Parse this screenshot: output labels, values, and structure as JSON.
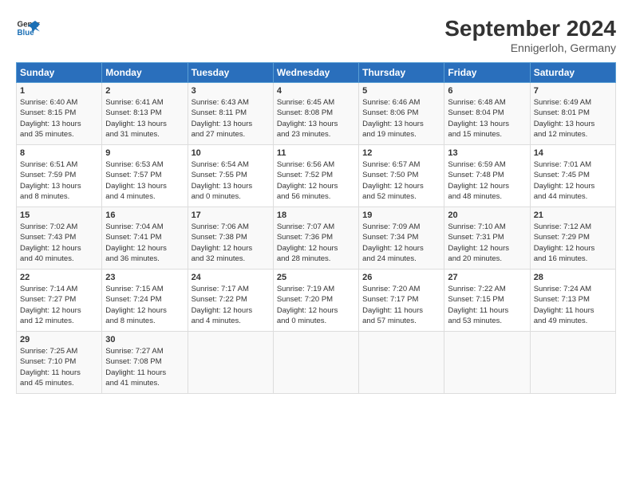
{
  "header": {
    "logo_line1": "General",
    "logo_line2": "Blue",
    "title": "September 2024",
    "subtitle": "Ennigerloh, Germany"
  },
  "days_of_week": [
    "Sunday",
    "Monday",
    "Tuesday",
    "Wednesday",
    "Thursday",
    "Friday",
    "Saturday"
  ],
  "rows": [
    [
      {
        "day": 1,
        "lines": [
          "Sunrise: 6:40 AM",
          "Sunset: 8:15 PM",
          "Daylight: 13 hours",
          "and 35 minutes."
        ]
      },
      {
        "day": 2,
        "lines": [
          "Sunrise: 6:41 AM",
          "Sunset: 8:13 PM",
          "Daylight: 13 hours",
          "and 31 minutes."
        ]
      },
      {
        "day": 3,
        "lines": [
          "Sunrise: 6:43 AM",
          "Sunset: 8:11 PM",
          "Daylight: 13 hours",
          "and 27 minutes."
        ]
      },
      {
        "day": 4,
        "lines": [
          "Sunrise: 6:45 AM",
          "Sunset: 8:08 PM",
          "Daylight: 13 hours",
          "and 23 minutes."
        ]
      },
      {
        "day": 5,
        "lines": [
          "Sunrise: 6:46 AM",
          "Sunset: 8:06 PM",
          "Daylight: 13 hours",
          "and 19 minutes."
        ]
      },
      {
        "day": 6,
        "lines": [
          "Sunrise: 6:48 AM",
          "Sunset: 8:04 PM",
          "Daylight: 13 hours",
          "and 15 minutes."
        ]
      },
      {
        "day": 7,
        "lines": [
          "Sunrise: 6:49 AM",
          "Sunset: 8:01 PM",
          "Daylight: 13 hours",
          "and 12 minutes."
        ]
      }
    ],
    [
      {
        "day": 8,
        "lines": [
          "Sunrise: 6:51 AM",
          "Sunset: 7:59 PM",
          "Daylight: 13 hours",
          "and 8 minutes."
        ]
      },
      {
        "day": 9,
        "lines": [
          "Sunrise: 6:53 AM",
          "Sunset: 7:57 PM",
          "Daylight: 13 hours",
          "and 4 minutes."
        ]
      },
      {
        "day": 10,
        "lines": [
          "Sunrise: 6:54 AM",
          "Sunset: 7:55 PM",
          "Daylight: 13 hours",
          "and 0 minutes."
        ]
      },
      {
        "day": 11,
        "lines": [
          "Sunrise: 6:56 AM",
          "Sunset: 7:52 PM",
          "Daylight: 12 hours",
          "and 56 minutes."
        ]
      },
      {
        "day": 12,
        "lines": [
          "Sunrise: 6:57 AM",
          "Sunset: 7:50 PM",
          "Daylight: 12 hours",
          "and 52 minutes."
        ]
      },
      {
        "day": 13,
        "lines": [
          "Sunrise: 6:59 AM",
          "Sunset: 7:48 PM",
          "Daylight: 12 hours",
          "and 48 minutes."
        ]
      },
      {
        "day": 14,
        "lines": [
          "Sunrise: 7:01 AM",
          "Sunset: 7:45 PM",
          "Daylight: 12 hours",
          "and 44 minutes."
        ]
      }
    ],
    [
      {
        "day": 15,
        "lines": [
          "Sunrise: 7:02 AM",
          "Sunset: 7:43 PM",
          "Daylight: 12 hours",
          "and 40 minutes."
        ]
      },
      {
        "day": 16,
        "lines": [
          "Sunrise: 7:04 AM",
          "Sunset: 7:41 PM",
          "Daylight: 12 hours",
          "and 36 minutes."
        ]
      },
      {
        "day": 17,
        "lines": [
          "Sunrise: 7:06 AM",
          "Sunset: 7:38 PM",
          "Daylight: 12 hours",
          "and 32 minutes."
        ]
      },
      {
        "day": 18,
        "lines": [
          "Sunrise: 7:07 AM",
          "Sunset: 7:36 PM",
          "Daylight: 12 hours",
          "and 28 minutes."
        ]
      },
      {
        "day": 19,
        "lines": [
          "Sunrise: 7:09 AM",
          "Sunset: 7:34 PM",
          "Daylight: 12 hours",
          "and 24 minutes."
        ]
      },
      {
        "day": 20,
        "lines": [
          "Sunrise: 7:10 AM",
          "Sunset: 7:31 PM",
          "Daylight: 12 hours",
          "and 20 minutes."
        ]
      },
      {
        "day": 21,
        "lines": [
          "Sunrise: 7:12 AM",
          "Sunset: 7:29 PM",
          "Daylight: 12 hours",
          "and 16 minutes."
        ]
      }
    ],
    [
      {
        "day": 22,
        "lines": [
          "Sunrise: 7:14 AM",
          "Sunset: 7:27 PM",
          "Daylight: 12 hours",
          "and 12 minutes."
        ]
      },
      {
        "day": 23,
        "lines": [
          "Sunrise: 7:15 AM",
          "Sunset: 7:24 PM",
          "Daylight: 12 hours",
          "and 8 minutes."
        ]
      },
      {
        "day": 24,
        "lines": [
          "Sunrise: 7:17 AM",
          "Sunset: 7:22 PM",
          "Daylight: 12 hours",
          "and 4 minutes."
        ]
      },
      {
        "day": 25,
        "lines": [
          "Sunrise: 7:19 AM",
          "Sunset: 7:20 PM",
          "Daylight: 12 hours",
          "and 0 minutes."
        ]
      },
      {
        "day": 26,
        "lines": [
          "Sunrise: 7:20 AM",
          "Sunset: 7:17 PM",
          "Daylight: 11 hours",
          "and 57 minutes."
        ]
      },
      {
        "day": 27,
        "lines": [
          "Sunrise: 7:22 AM",
          "Sunset: 7:15 PM",
          "Daylight: 11 hours",
          "and 53 minutes."
        ]
      },
      {
        "day": 28,
        "lines": [
          "Sunrise: 7:24 AM",
          "Sunset: 7:13 PM",
          "Daylight: 11 hours",
          "and 49 minutes."
        ]
      }
    ],
    [
      {
        "day": 29,
        "lines": [
          "Sunrise: 7:25 AM",
          "Sunset: 7:10 PM",
          "Daylight: 11 hours",
          "and 45 minutes."
        ]
      },
      {
        "day": 30,
        "lines": [
          "Sunrise: 7:27 AM",
          "Sunset: 7:08 PM",
          "Daylight: 11 hours",
          "and 41 minutes."
        ]
      },
      null,
      null,
      null,
      null,
      null
    ]
  ]
}
